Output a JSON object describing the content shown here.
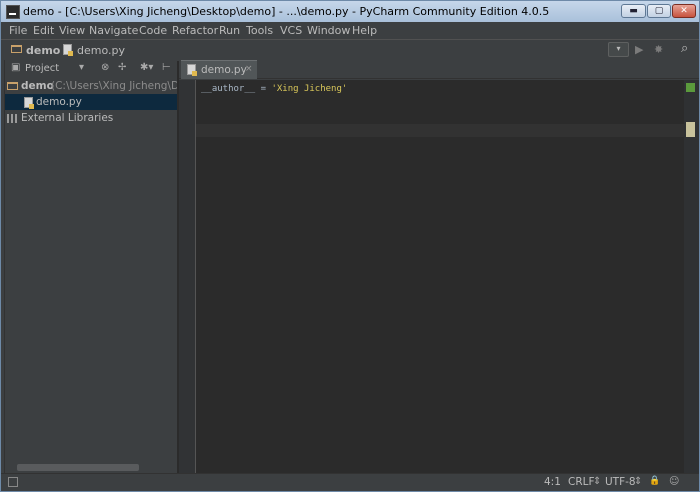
{
  "window": {
    "title": "demo - [C:\\Users\\Xing Jicheng\\Desktop\\demo] - ...\\demo.py - PyCharm Community Edition 4.0.5",
    "min_glyph": "▬",
    "max_glyph": "▢",
    "close_glyph": "✕"
  },
  "menu": [
    "File",
    "Edit",
    "View",
    "Navigate",
    "Code",
    "Refactor",
    "Run",
    "Tools",
    "VCS",
    "Window",
    "Help"
  ],
  "navbar": {
    "project": "demo",
    "file": "demo.py",
    "config_arrow": "▾",
    "run_glyph": "▶",
    "debug_glyph": "✸",
    "search_glyph": "⌕"
  },
  "project_panel": {
    "title": "Project",
    "dropdown": "▾",
    "icons": [
      "⊗",
      "✢",
      "✱▾",
      "⊢"
    ]
  },
  "tree": {
    "root_name": "demo",
    "root_path": "(C:\\Users\\Xing Jicheng\\Desk",
    "file": "demo.py",
    "libraries": "External Libraries"
  },
  "tabs": [
    {
      "label": "demo.py",
      "close": "×"
    }
  ],
  "editor": {
    "code_prefix": "__author__ = ",
    "code_string": "'Xing Jicheng'"
  },
  "status": {
    "position": "4:1",
    "line_sep": "CRLF",
    "encoding": "UTF-8",
    "sep_glyph": "⇕",
    "enc_glyph": "⇕",
    "lock_glyph": "🔒",
    "insp_glyph": "☺"
  },
  "colors": {
    "editor_bg": "#2b2b2b",
    "panel_bg": "#3c3f41",
    "selection": "#0d293e",
    "string": "#d9c75a",
    "text": "#a9b7c6"
  }
}
